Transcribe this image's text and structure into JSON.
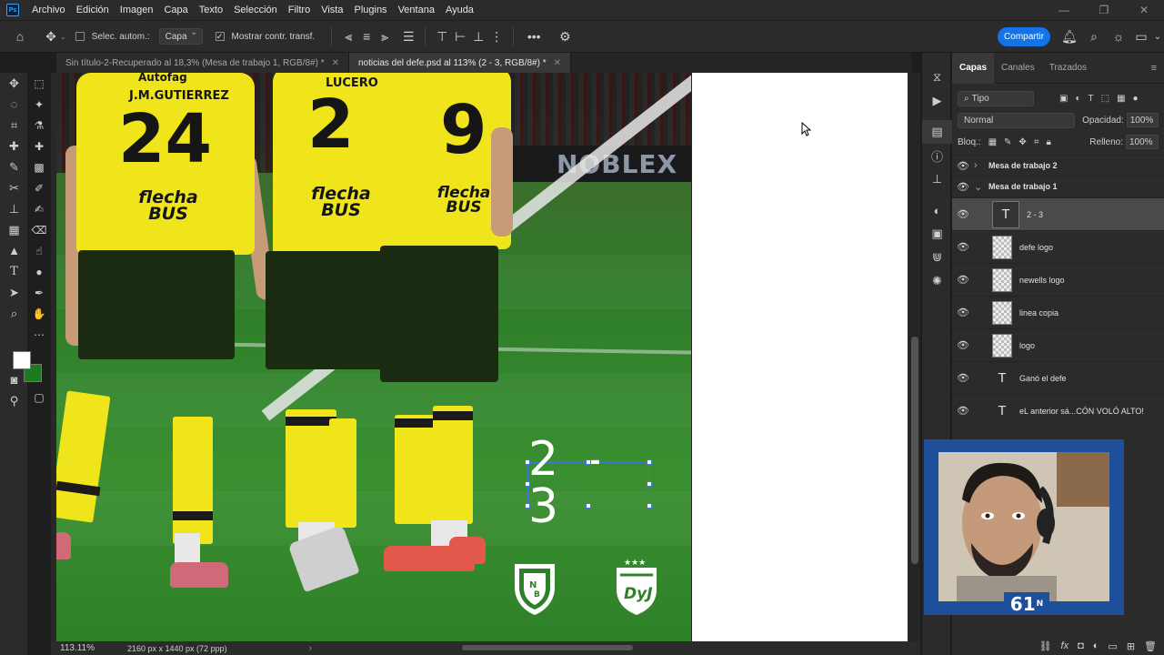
{
  "menu": [
    "Archivo",
    "Edición",
    "Imagen",
    "Capa",
    "Texto",
    "Selección",
    "Filtro",
    "Vista",
    "Plugins",
    "Ventana",
    "Ayuda"
  ],
  "options": {
    "auto_select_label": "Selec. autom.:",
    "auto_select_value": "Capa",
    "show_transform_label": "Mostrar contr. transf.",
    "share_label": "Compartir"
  },
  "tabs": [
    {
      "label": "Sin título-2-Recuperado al 18,3% (Mesa de trabajo 1, RGB/8#) *"
    },
    {
      "label": "noticias del defe.psd al 113% (2 - 3, RGB/8#) *"
    }
  ],
  "canvas": {
    "score": "2 - 3",
    "adboard": "NOBLEX",
    "players": [
      {
        "name": "J.M.GUTIERREZ",
        "number": "24",
        "sponsor": "flecha BUS",
        "top_text": "Autofag"
      },
      {
        "name": "LUCERO",
        "number": "2",
        "sponsor": "flecha BUS"
      },
      {
        "name": "",
        "number": "9",
        "sponsor": "flecha BUS"
      }
    ],
    "crest_left": "NOB",
    "crest_right": "DyJ"
  },
  "status": {
    "zoom": "113.11%",
    "doc_info": "2160 px x 1440 px (72 ppp)"
  },
  "layers_panel": {
    "tabs": [
      "Capas",
      "Canales",
      "Trazados"
    ],
    "filter": "Tipo",
    "blend_mode": "Normal",
    "opacity_label": "Opacidad:",
    "opacity_value": "100%",
    "lock_label": "Bloq.:",
    "fill_label": "Relleno:",
    "fill_value": "100%",
    "layers": [
      {
        "name": "Mesa de trabajo 2",
        "kind": "group"
      },
      {
        "name": "Mesa de trabajo 1",
        "kind": "group"
      },
      {
        "name": "2 - 3",
        "kind": "text",
        "selected": true
      },
      {
        "name": "defe logo",
        "kind": "raster"
      },
      {
        "name": "newells logo",
        "kind": "raster"
      },
      {
        "name": "linea copia",
        "kind": "raster"
      },
      {
        "name": "logo",
        "kind": "raster"
      },
      {
        "name": "Ganó el defe",
        "kind": "text"
      },
      {
        "name": "eL anterior sá...CÓN VOLÓ ALTO!",
        "kind": "text"
      }
    ]
  },
  "webcam": {
    "badge": "61",
    "badge_sup": "N"
  },
  "colors": {
    "foreground": "#ffffff",
    "background": "#1e7a1e",
    "accent": "#1473e6",
    "jersey": "#f0e51a",
    "webcam_frame": "#1d4f9b"
  }
}
